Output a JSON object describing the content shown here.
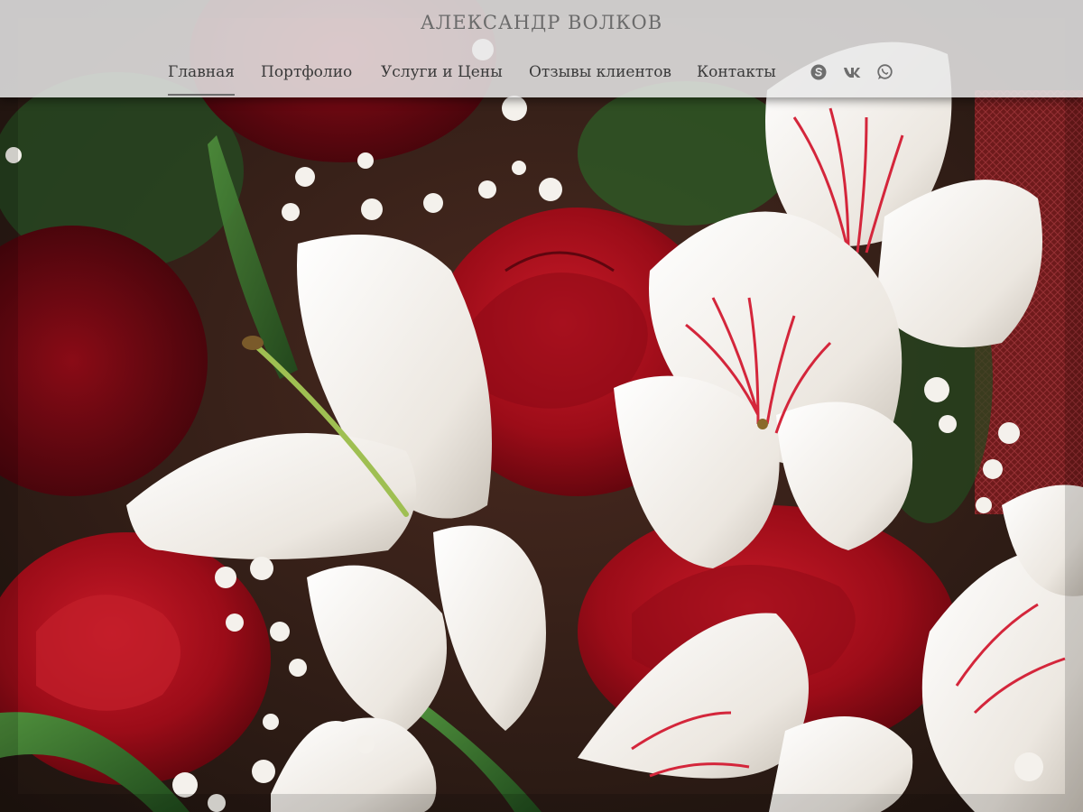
{
  "site": {
    "title": "Александр Волков"
  },
  "nav": {
    "items": [
      {
        "label": "Главная",
        "active": true
      },
      {
        "label": "Портфолио",
        "active": false
      },
      {
        "label": "Услуги и Цены",
        "active": false
      },
      {
        "label": "Отзывы клиентов",
        "active": false
      },
      {
        "label": "Контакты",
        "active": false
      }
    ]
  },
  "social": {
    "icons": [
      "skype-icon",
      "vk-icon",
      "whatsapp-icon"
    ]
  },
  "hero": {
    "image": "bouquet-photo",
    "palette": {
      "rose": "#b0101c",
      "lily": "#f3efe9",
      "leaf": "#2f6a2a",
      "stripe": "#d4263b"
    }
  }
}
